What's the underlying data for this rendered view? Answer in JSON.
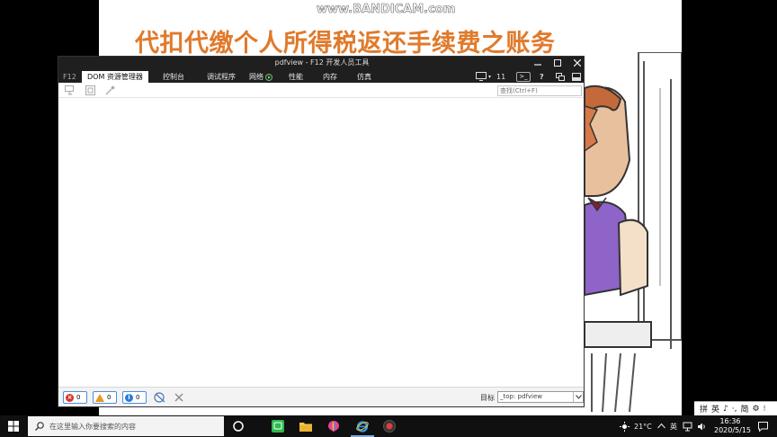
{
  "slide": {
    "watermark": "www.BANDICAM.com",
    "title": "代扣代缴个人所得税返还手续费之账务"
  },
  "devtools": {
    "window_title": "pdfview - F12 开发人员工具",
    "f12_label": "F12",
    "tabs": [
      {
        "label": "DOM 资源管理器",
        "active": true
      },
      {
        "label": "控制台",
        "active": false
      },
      {
        "label": "调试程序",
        "active": false
      },
      {
        "label": "网络",
        "active": false
      },
      {
        "label": "性能",
        "active": false
      },
      {
        "label": "内存",
        "active": false
      },
      {
        "label": "仿真",
        "active": false
      }
    ],
    "device_count": "11",
    "console_glyph": ">_",
    "help_glyph": "?",
    "find_placeholder": "查找(Ctrl+F)",
    "status": {
      "errors": "0",
      "warnings": "0",
      "messages": "0",
      "target_label": "目标",
      "target_value": "_top: pdfview"
    }
  },
  "ime": {
    "items": [
      "拼",
      "英",
      "♪",
      "·,",
      "简",
      "⚙",
      "⁝"
    ]
  },
  "taskbar": {
    "search_placeholder": "在这里输入你要搜索的内容",
    "temperature": "21°C",
    "ime_label": "英",
    "time": "16:36",
    "date": "2020/5/15"
  },
  "colors": {
    "title_orange": "#e07a2c",
    "devtools_bar": "#1f1f1f",
    "error_red": "#d9302c",
    "warning_orange": "#e69a1e",
    "info_blue": "#2b7bd6"
  }
}
